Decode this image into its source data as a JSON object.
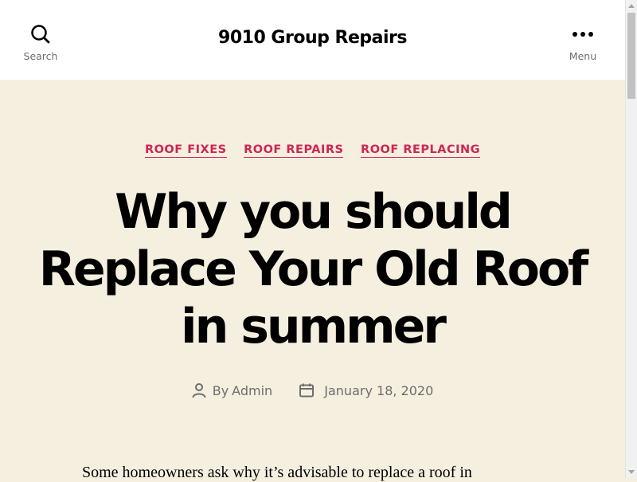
{
  "header": {
    "site_title": "9010 Group Repairs",
    "search_label": "Search",
    "menu_label": "Menu"
  },
  "post": {
    "categories": [
      "ROOF FIXES",
      "ROOF REPAIRS",
      "ROOF REPLACING"
    ],
    "title_lines": [
      "Why you should",
      "Replace Your Old Roof",
      "in summer"
    ],
    "by_label": "By",
    "author": "Admin",
    "date": "January 18, 2020",
    "excerpt": "Some homeowners ask why it’s advisable to replace a roof in"
  },
  "colors": {
    "accent": "#cd2653",
    "background": "#f5efe0",
    "header_bg": "#ffffff",
    "meta_text": "#6d6d6d"
  },
  "icons": {
    "search": "search-icon",
    "menu": "menu-dots-icon",
    "author": "person-icon",
    "date": "calendar-icon"
  }
}
